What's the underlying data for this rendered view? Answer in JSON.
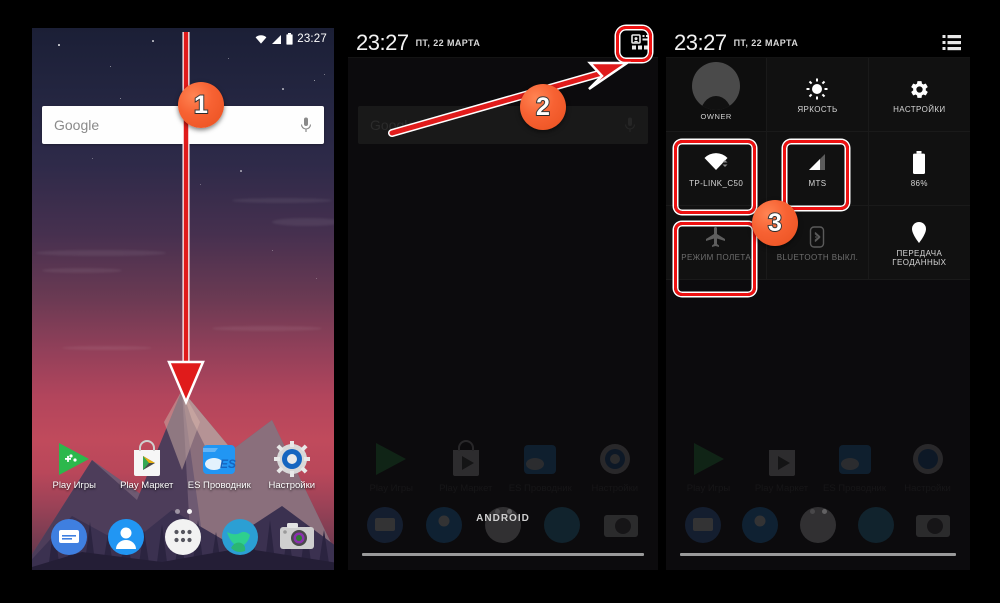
{
  "panels": [
    {
      "id": "home-screen",
      "statusbar": {
        "time": "23:27",
        "icons": [
          "wifi-icon",
          "signal-icon",
          "battery-icon"
        ]
      },
      "search": {
        "label": "Google",
        "mic": "microphone-icon"
      },
      "apps": [
        {
          "label": "Play Игры",
          "icon": "play-games-icon"
        },
        {
          "label": "Play Маркет",
          "icon": "play-store-icon"
        },
        {
          "label": "ES Проводник",
          "icon": "es-explorer-icon"
        },
        {
          "label": "Настройки",
          "icon": "settings-gear-icon"
        }
      ],
      "dock": [
        {
          "icon": "messaging-icon"
        },
        {
          "icon": "contacts-icon"
        },
        {
          "icon": "app-drawer-icon"
        },
        {
          "icon": "browser-icon"
        },
        {
          "icon": "camera-icon"
        }
      ],
      "pages": {
        "count": 2,
        "active": 2
      }
    },
    {
      "id": "shade-collapsed",
      "shade": {
        "time": "23:27",
        "date": "ПТ, 22 МАРТА",
        "toggle_icon": "quick-settings-grid-icon"
      },
      "dim_search_label": "Google",
      "watermark": "ANDROID"
    },
    {
      "id": "quick-settings",
      "shade": {
        "time": "23:27",
        "date": "ПТ, 22 МАРТА",
        "toggle_icon": "notifications-list-icon"
      },
      "tiles": [
        {
          "label": "OWNER",
          "icon": "user-avatar-icon",
          "state": "user"
        },
        {
          "label": "ЯРКОСТЬ",
          "icon": "brightness-sun-icon",
          "state": "on"
        },
        {
          "label": "НАСТРОЙКИ",
          "icon": "settings-gear-icon",
          "state": "on"
        },
        {
          "label": "TP-LINK_C50",
          "icon": "wifi-icon",
          "state": "on"
        },
        {
          "label": "MTS",
          "icon": "cellular-signal-icon",
          "state": "on"
        },
        {
          "label": "86%",
          "icon": "battery-icon",
          "state": "on"
        },
        {
          "label": "РЕЖИМ ПОЛЕТА",
          "icon": "airplane-icon",
          "state": "off"
        },
        {
          "label": "BLUETOOTH ВЫКЛ.",
          "icon": "bluetooth-icon",
          "state": "off"
        },
        {
          "label": "ПЕРЕДАЧА ГЕОДАННЫХ",
          "icon": "location-pin-icon",
          "state": "on"
        }
      ]
    }
  ],
  "annotations": {
    "badges": [
      {
        "number": "1",
        "meaning": "swipe-down-gesture"
      },
      {
        "number": "2",
        "meaning": "tap-quick-settings-toggle"
      },
      {
        "number": "3",
        "meaning": "toggle-connectivity-tiles"
      }
    ],
    "accent_color": "#f2602e",
    "highlight_color": "#ee1111"
  }
}
